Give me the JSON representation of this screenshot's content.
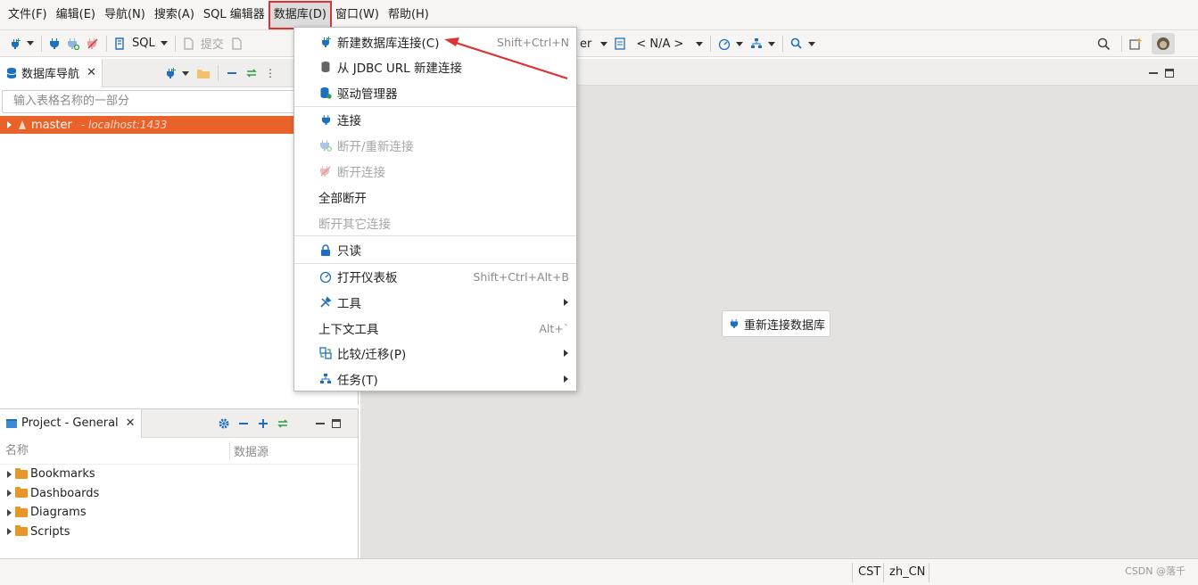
{
  "menubar": {
    "items": [
      "文件(F)",
      "编辑(E)",
      "导航(N)",
      "搜索(A)",
      "SQL 编辑器",
      "数据库(D)",
      "窗口(W)",
      "帮助(H)"
    ]
  },
  "toolbar": {
    "sql_label": "SQL",
    "commit_label": "提交",
    "partial_user": "er",
    "schema_value": "< N/A >"
  },
  "navigator": {
    "tab_title": "数据库导航",
    "filter_placeholder": "输入表格名称的一部分",
    "connection_name": "master",
    "connection_host": "- localhost:1433"
  },
  "project": {
    "tab_title": "Project - General",
    "col_name": "名称",
    "col_datasource": "数据源",
    "items": [
      "Bookmarks",
      "Dashboards",
      "Diagrams",
      "Scripts"
    ]
  },
  "editor": {
    "reconnect_label": "重新连接数据库"
  },
  "dropdown": {
    "new_connection": "新建数据库连接(C)",
    "new_connection_shortcut": "Shift+Ctrl+N",
    "new_from_jdbc": "从 JDBC URL 新建连接",
    "driver_manager": "驱动管理器",
    "connect": "连接",
    "reconnect": "断开/重新连接",
    "disconnect": "断开连接",
    "disconnect_all": "全部断开",
    "disconnect_others": "断开其它连接",
    "read_only": "只读",
    "open_dashboard": "打开仪表板",
    "open_dashboard_shortcut": "Shift+Ctrl+Alt+B",
    "tools": "工具",
    "context_tools": "上下文工具",
    "context_tools_shortcut": "Alt+`",
    "compare_migrate": "比较/迁移(P)",
    "tasks": "任务(T)"
  },
  "statusbar": {
    "timezone": "CST",
    "locale": "zh_CN"
  },
  "watermark": "CSDN @落千",
  "colors": {
    "selection": "#e8622a",
    "highlight_border": "#e03030",
    "annotation_arrow": "#e03030",
    "icon_blue": "#1e6fbf"
  }
}
